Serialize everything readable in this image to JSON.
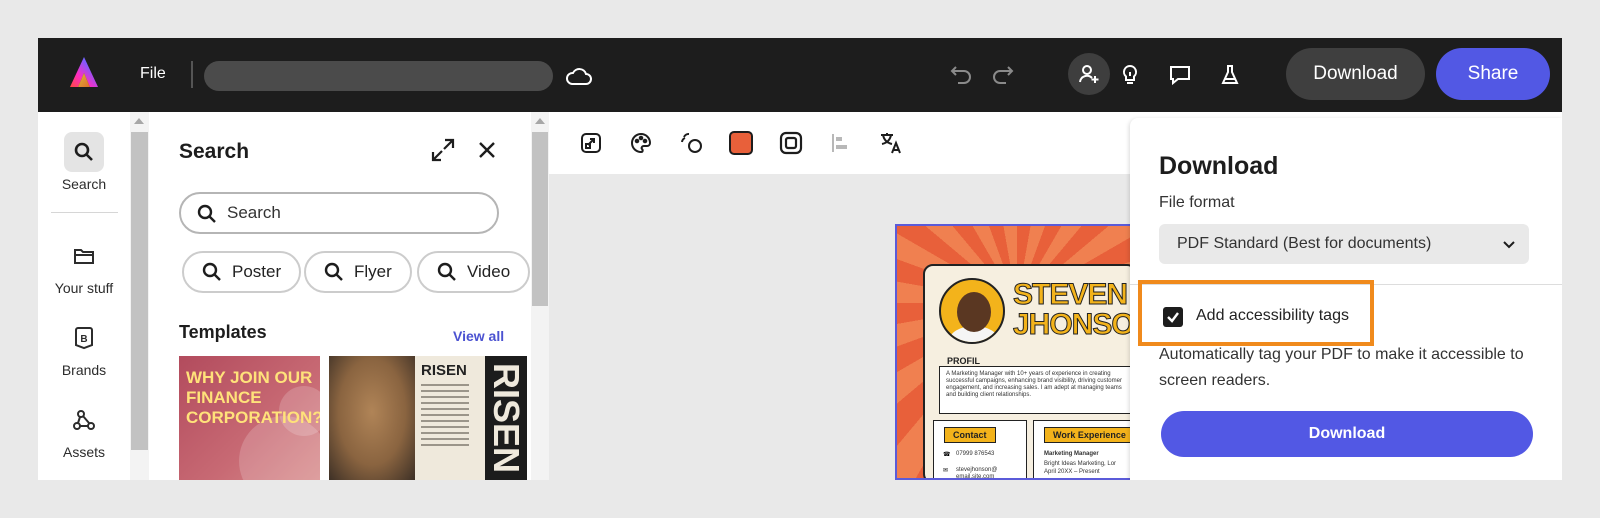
{
  "topbar": {
    "file_label": "File",
    "download_label": "Download",
    "share_label": "Share",
    "icons": [
      "adobe-express-logo",
      "cloud-icon",
      "undo-icon",
      "redo-icon",
      "invite-user-icon",
      "lightbulb-icon",
      "comment-icon",
      "flask-icon"
    ],
    "accent_color": "#5258e4"
  },
  "rail": {
    "items": [
      {
        "label": "Search",
        "icon": "search-icon",
        "active": true
      },
      {
        "label": "Your stuff",
        "icon": "folder-icon"
      },
      {
        "label": "Brands",
        "icon": "brand-icon"
      },
      {
        "label": "Assets",
        "icon": "assets-icon"
      }
    ]
  },
  "search_panel": {
    "title": "Search",
    "search_placeholder": "Search",
    "chips": [
      "Poster",
      "Flyer",
      "Video"
    ],
    "templates_title": "Templates",
    "view_all": "View all",
    "templates": [
      {
        "text": "WHY JOIN OUR FINANCE CORPORATION?"
      },
      {
        "title_small": "RISEN",
        "title_big": "RISEN"
      }
    ]
  },
  "canvas": {
    "toolbar_icons": [
      "resize-icon",
      "palette-icon",
      "animate-icon",
      "color-swatch-icon",
      "frame-icon",
      "align-icon",
      "translate-icon"
    ],
    "swatch_color": "#e8603a",
    "document": {
      "name_line1": "STEVEN",
      "name_line2": "JHONSON",
      "profil_heading": "PROFIL",
      "profil_text": "A Marketing Manager with 10+ years of experience in creating successful campaigns, enhancing brand visibility, driving customer engagement, and increasing sales. I am adept at managing teams and building client relationships.",
      "contact_heading": "Contact",
      "contact_phone": "07999 876543",
      "contact_email": "stevejhonson@ email.site.com",
      "work_heading": "Work Experience",
      "work_role": "Marketing Manager",
      "work_company": "Bright Ideas Marketing, Lor",
      "work_dates": "April 20XX – Present"
    }
  },
  "download_panel": {
    "title": "Download",
    "file_format_label": "File format",
    "file_format_value": "PDF Standard (Best for documents)",
    "accessibility_label": "Add accessibility tags",
    "accessibility_checked": true,
    "accessibility_desc": "Automatically tag your PDF to make it accessible to screen readers.",
    "download_button": "Download",
    "highlight_color": "#f08a1c"
  }
}
